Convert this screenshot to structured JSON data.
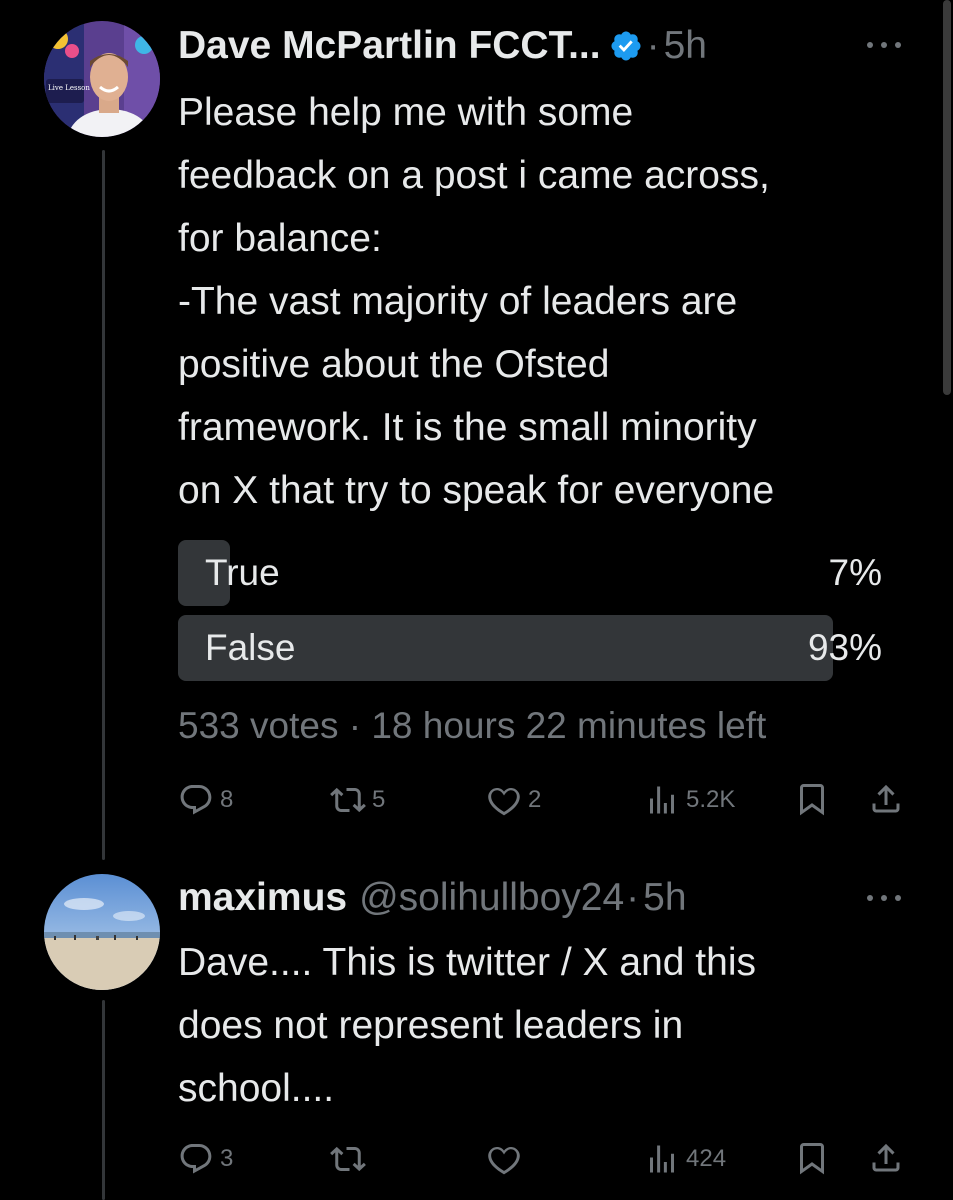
{
  "post": {
    "display_name": "Dave McPartlin FCCT...",
    "time_sep": "·",
    "time": "5h",
    "avatar_caption": "Live Lesson",
    "lines": [
      "Please help me with some",
      "feedback on a post i came across,",
      "for balance:",
      "-The vast majority of leaders are",
      "positive about the Ofsted",
      "framework. It is the small minority",
      "on X that try to speak for everyone"
    ],
    "poll": {
      "options": [
        {
          "label": "True",
          "percent_text": "7%",
          "share": 0.07
        },
        {
          "label": "False",
          "percent_text": "93%",
          "share": 0.93
        }
      ],
      "meta": "533 votes · 18 hours 22 minutes left"
    },
    "actions": {
      "replies": "8",
      "reposts": "5",
      "likes": "2",
      "views": "5.2K"
    }
  },
  "reply": {
    "display_name": "maximus",
    "handle": "@solihullboy24",
    "time_sep": "·",
    "time": "5h",
    "lines": [
      "Dave.... This is twitter / X and this",
      "does not represent leaders in",
      "school...."
    ],
    "actions": {
      "replies": "3",
      "reposts": "",
      "likes": "",
      "views": "424"
    }
  },
  "colors": {
    "background": "#000000",
    "text": "#e7e9ea",
    "muted": "#71767b",
    "verified": "#1d9bf0",
    "poll_bar": "#333639"
  }
}
